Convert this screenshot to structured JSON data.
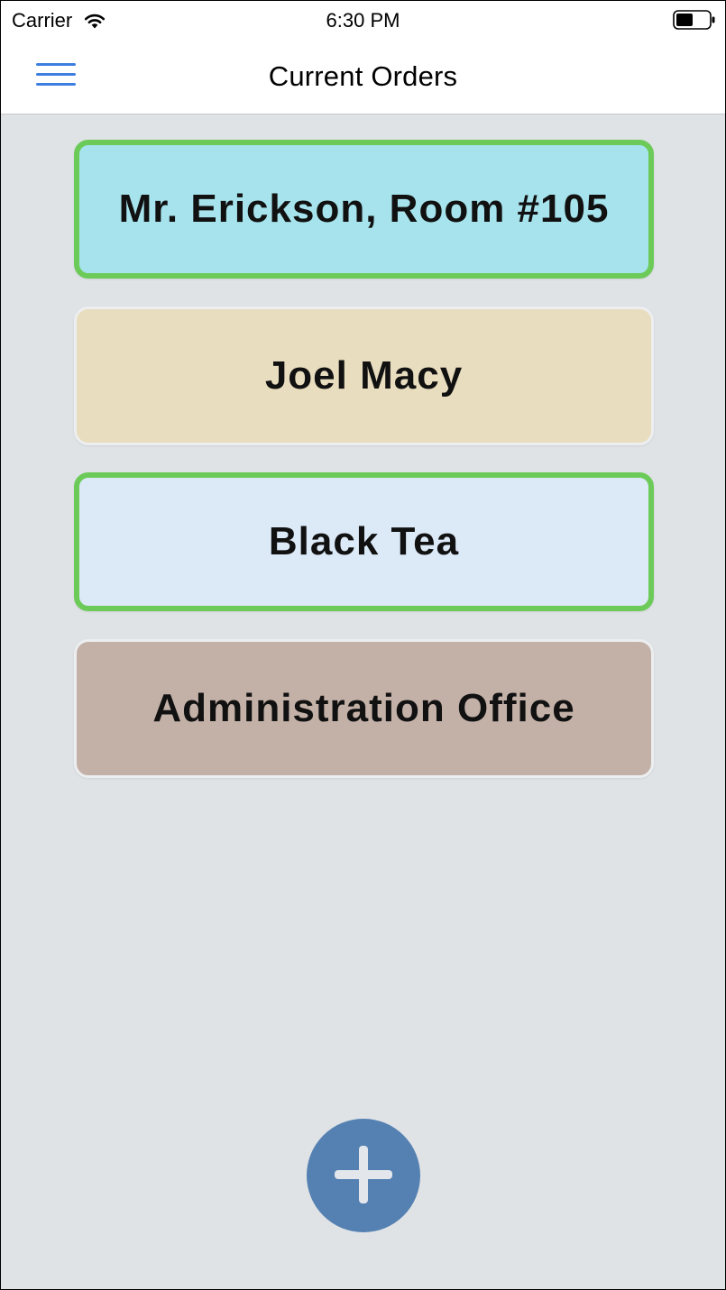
{
  "status_bar": {
    "carrier": "Carrier",
    "time": "6:30 PM"
  },
  "nav": {
    "title": "Current Orders"
  },
  "orders": [
    {
      "label": "Mr. Erickson, Room #105",
      "color": "#a6e3ec",
      "selected": true
    },
    {
      "label": "Joel Macy",
      "color": "#e9ddbf",
      "selected": false
    },
    {
      "label": "Black Tea",
      "color": "#dce9f7",
      "selected": true
    },
    {
      "label": "Administration Office",
      "color": "#c3b1a8",
      "selected": false
    }
  ],
  "colors": {
    "accent_blue": "#3d7ee0",
    "selected_border": "#6ccb58",
    "fab": "#5581b2",
    "background": "#dfe3e6"
  },
  "icons": {
    "menu": "hamburger-menu-icon",
    "add": "plus-icon",
    "wifi": "wifi-icon",
    "battery": "battery-icon"
  }
}
